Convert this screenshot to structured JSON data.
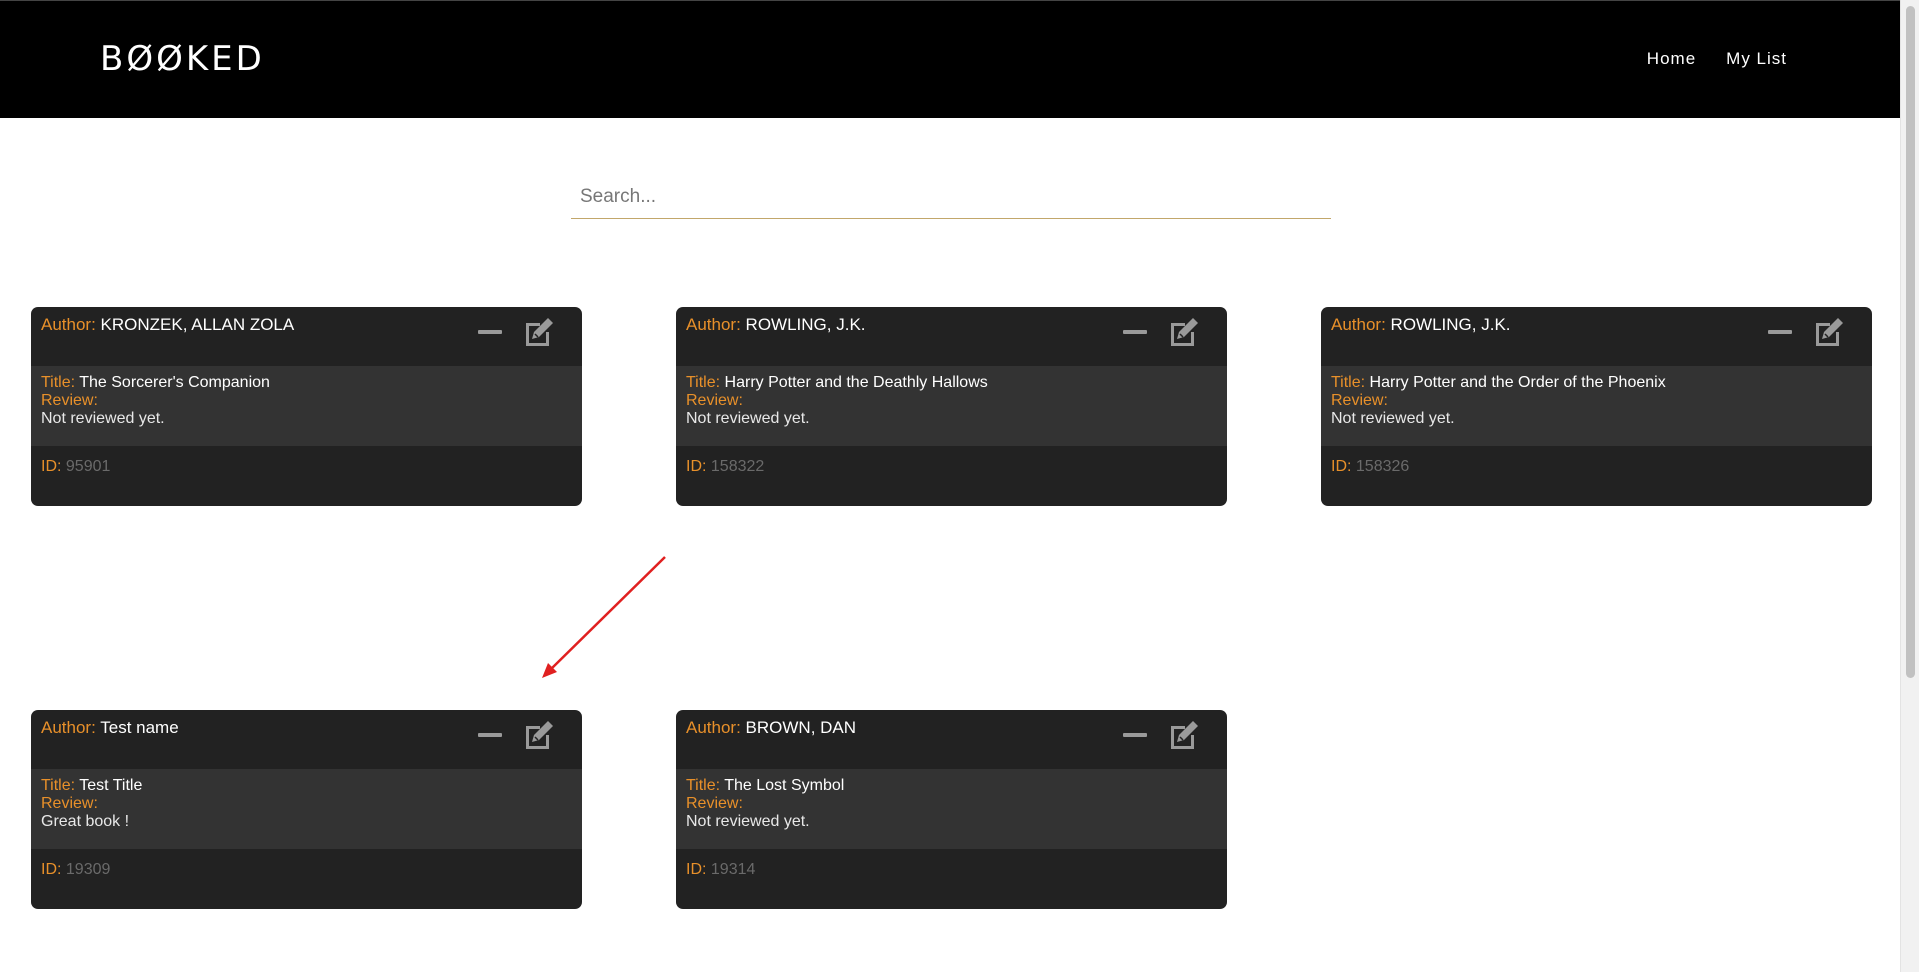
{
  "app": {
    "brand": "BØØKED"
  },
  "nav": {
    "items": [
      {
        "label": "Home"
      },
      {
        "label": "My List"
      }
    ]
  },
  "search": {
    "placeholder": "Search...",
    "value": ""
  },
  "labels": {
    "author": "Author:",
    "title": "Title:",
    "review": "Review:",
    "id": "ID:"
  },
  "cards": [
    {
      "author": "KRONZEK, ALLAN ZOLA",
      "title": "The Sorcerer's Companion",
      "review": "Not reviewed yet.",
      "id": "95901"
    },
    {
      "author": "ROWLING, J.K.",
      "title": "Harry Potter and the Deathly Hallows",
      "review": "Not reviewed yet.",
      "id": "158322"
    },
    {
      "author": "ROWLING, J.K.",
      "title": "Harry Potter and the Order of the Phoenix",
      "review": "Not reviewed yet.",
      "id": "158326"
    },
    {
      "author": "Test name",
      "title": "Test Title",
      "review": "Great book !",
      "id": "19309"
    },
    {
      "author": "BROWN, DAN",
      "title": "The Lost Symbol",
      "review": "Not reviewed yet.",
      "id": "19314"
    }
  ],
  "icons": {
    "remove": "minus-icon",
    "edit": "edit-icon"
  },
  "colors": {
    "navbar": "#000000",
    "card": "#222222",
    "card_body": "#333333",
    "label_accent": "#e8902a",
    "id_value": "#6a6a6a",
    "search_underline": "#c2a76b",
    "annotation_arrow": "#e02020"
  }
}
